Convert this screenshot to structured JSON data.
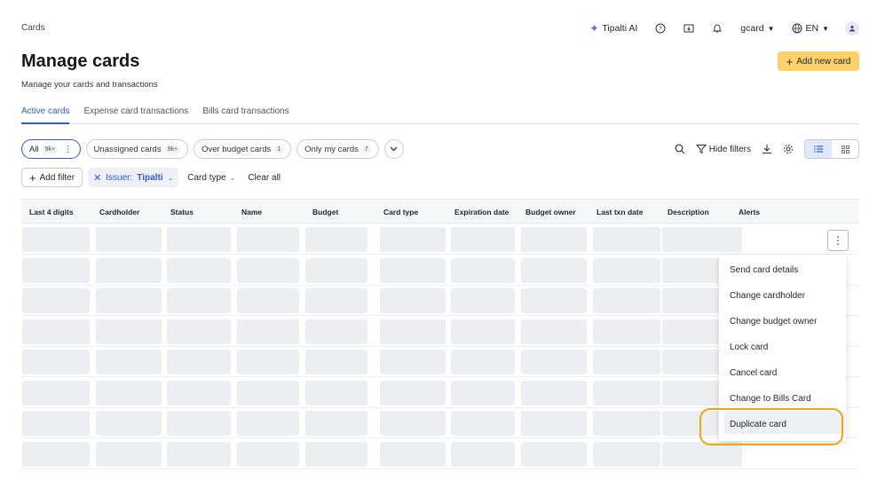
{
  "header": {
    "breadcrumb": "Cards",
    "ai_label": "Tipalti AI",
    "user": "gcard",
    "lang": "EN"
  },
  "page": {
    "title": "Manage cards",
    "subtitle": "Manage your cards and transactions",
    "add_button": "Add new card"
  },
  "tabs": [
    {
      "label": "Active cards",
      "active": true
    },
    {
      "label": "Expense card transactions"
    },
    {
      "label": "Bills card transactions"
    }
  ],
  "chips": [
    {
      "label": "All",
      "count": "9k+"
    },
    {
      "label": "Unassigned cards",
      "count": "9k+"
    },
    {
      "label": "Over budget cards",
      "count": "1"
    },
    {
      "label": "Only my cards",
      "count": "7"
    }
  ],
  "tools": {
    "hide_filters": "Hide filters"
  },
  "filters": {
    "add_filter": "Add filter",
    "issuer_prefix": "Issuer:",
    "issuer_value": "Tipalti",
    "card_type": "Card type",
    "clear_all": "Clear all"
  },
  "table": {
    "columns": [
      "Last 4 digits",
      "Cardholder",
      "Status",
      "Name",
      "Budget",
      "Card type",
      "Expiration date",
      "Budget owner",
      "Last txn date",
      "Description",
      "Alerts"
    ]
  },
  "menu": {
    "items": [
      "Send card details",
      "Change cardholder",
      "Change budget owner",
      "Lock card",
      "Cancel card",
      "Change to Bills Card",
      "Duplicate card"
    ],
    "highlighted": "Duplicate card"
  },
  "colors": {
    "accent": "#2f5bd6",
    "primary_button": "#fbd26a",
    "highlight_ring": "#e8a90e"
  }
}
